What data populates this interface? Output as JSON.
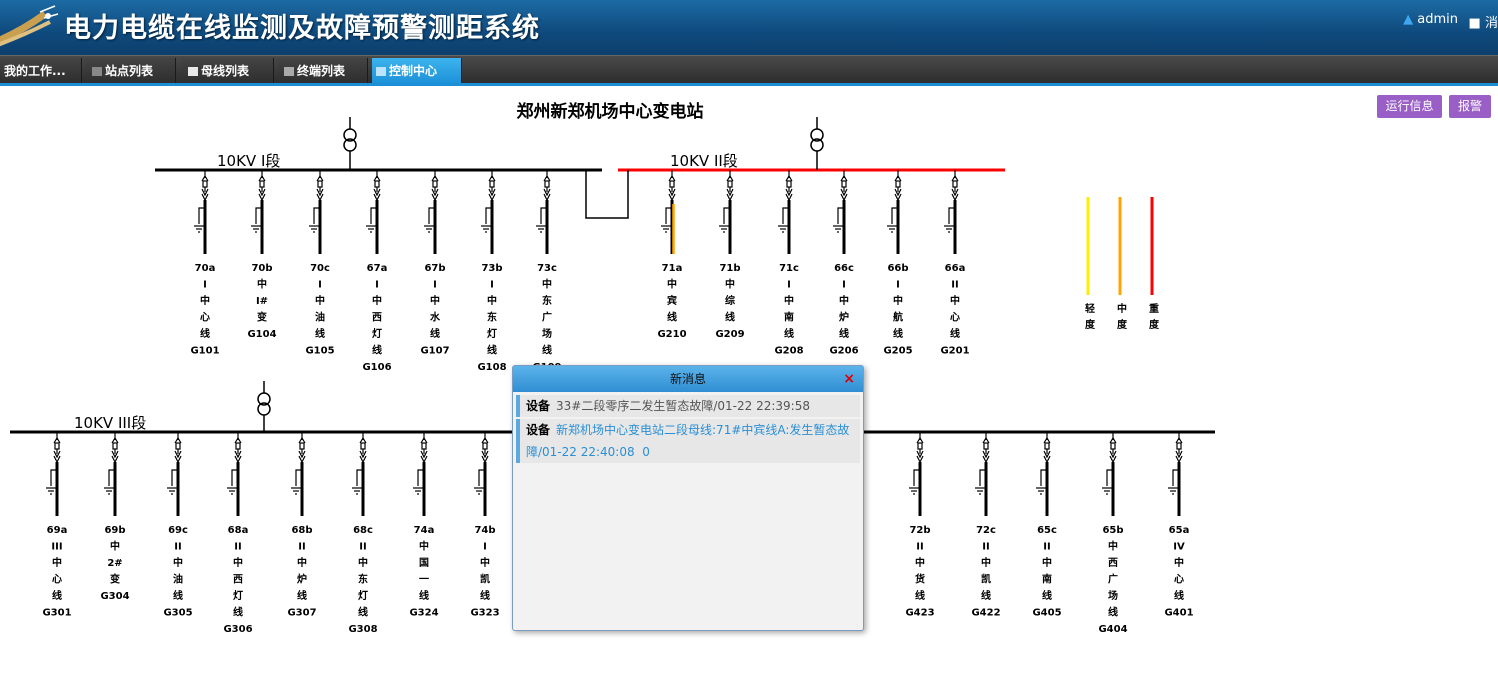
{
  "header": {
    "title": "电力电缆在线监测及故障预警测距系统",
    "user": "admin",
    "msg_label": "消"
  },
  "nav": {
    "tabs": [
      {
        "label": "我的工作..."
      },
      {
        "label": "站点列表"
      },
      {
        "label": "母线列表"
      },
      {
        "label": "终端列表"
      },
      {
        "label": "控制中心"
      }
    ]
  },
  "buttons": {
    "run_info": "运行信息",
    "alarm": "报警"
  },
  "station": {
    "title": "郑州新郑机场中心变电站"
  },
  "buses": [
    {
      "label": "10KV I段"
    },
    {
      "label": "10KV II段"
    },
    {
      "label": "10KV III段"
    }
  ],
  "colors": {
    "normal": "#000000",
    "fault_bus": "#ff0000",
    "light": "#ffee00",
    "medium": "#ffa500",
    "heavy": "#ff0000",
    "button": "#9a5fc7",
    "accent": "#1b8fd6"
  },
  "legend": [
    {
      "label": "轻度",
      "color": "#ffee00"
    },
    {
      "label": "中度",
      "color": "#ffa500"
    },
    {
      "label": "重度",
      "color": "#ff0000"
    }
  ],
  "feeders_top": [
    {
      "id": "70a",
      "lines": [
        "I",
        "中",
        "心",
        "线"
      ],
      "code": "G101"
    },
    {
      "id": "70b",
      "lines": [
        "中",
        "I#",
        "变"
      ],
      "code": "G104"
    },
    {
      "id": "70c",
      "lines": [
        "I",
        "中",
        "油",
        "线"
      ],
      "code": "G105"
    },
    {
      "id": "67a",
      "lines": [
        "I",
        "中",
        "西",
        "灯",
        "线"
      ],
      "code": "G106"
    },
    {
      "id": "67b",
      "lines": [
        "I",
        "中",
        "水",
        "线"
      ],
      "code": "G107"
    },
    {
      "id": "73b",
      "lines": [
        "I",
        "中",
        "东",
        "灯",
        "线"
      ],
      "code": "G108"
    },
    {
      "id": "73c",
      "lines": [
        "中",
        "东",
        "广",
        "场",
        "线"
      ],
      "code": "G109"
    },
    {
      "id": "71a",
      "lines": [
        "中",
        "宾",
        "线"
      ],
      "code": "G210"
    },
    {
      "id": "71b",
      "lines": [
        "中",
        "综",
        "线"
      ],
      "code": "G209"
    },
    {
      "id": "71c",
      "lines": [
        "I",
        "中",
        "南",
        "线"
      ],
      "code": "G208"
    },
    {
      "id": "66c",
      "lines": [
        "I",
        "中",
        "炉",
        "线"
      ],
      "code": "G206"
    },
    {
      "id": "66b",
      "lines": [
        "I",
        "中",
        "航",
        "线"
      ],
      "code": "G205"
    },
    {
      "id": "66a",
      "lines": [
        "II",
        "中",
        "心",
        "线"
      ],
      "code": "G201"
    }
  ],
  "feeders_bottom": [
    {
      "id": "69a",
      "lines": [
        "III",
        "中",
        "心",
        "线"
      ],
      "code": "G301"
    },
    {
      "id": "69b",
      "lines": [
        "中",
        "2#",
        "变"
      ],
      "code": "G304"
    },
    {
      "id": "69c",
      "lines": [
        "II",
        "中",
        "油",
        "线"
      ],
      "code": "G305"
    },
    {
      "id": "68a",
      "lines": [
        "II",
        "中",
        "西",
        "灯",
        "线"
      ],
      "code": "G306"
    },
    {
      "id": "68b",
      "lines": [
        "II",
        "中",
        "炉",
        "线"
      ],
      "code": "G307"
    },
    {
      "id": "68c",
      "lines": [
        "II",
        "中",
        "东",
        "灯",
        "线"
      ],
      "code": "G308"
    },
    {
      "id": "74a",
      "lines": [
        "中",
        "国",
        "一",
        "线"
      ],
      "code": "G324"
    },
    {
      "id": "74b",
      "lines": [
        "I",
        "中",
        "凯",
        "线"
      ],
      "code": "G323"
    },
    {
      "id": "72b",
      "lines": [
        "II",
        "中",
        "货",
        "线"
      ],
      "code": "G423"
    },
    {
      "id": "72c",
      "lines": [
        "II",
        "中",
        "凯",
        "线"
      ],
      "code": "G422"
    },
    {
      "id": "65c",
      "lines": [
        "II",
        "中",
        "南",
        "线"
      ],
      "code": "G405"
    },
    {
      "id": "65b",
      "lines": [
        "中",
        "西",
        "广",
        "场",
        "线"
      ],
      "code": "G404"
    },
    {
      "id": "65a",
      "lines": [
        "IV",
        "中",
        "心",
        "线"
      ],
      "code": "G401"
    }
  ],
  "dialog": {
    "title": "新消息",
    "close": "×",
    "messages": [
      {
        "key": "设备",
        "text": "33#二段零序二发生暂态故障/01-22 22:39:58"
      },
      {
        "key": "设备",
        "text": "新郑机场中心变电站二段母线:71#中宾线A:发生暂态故障/01-22 22:40:08",
        "extra": "0"
      }
    ]
  }
}
